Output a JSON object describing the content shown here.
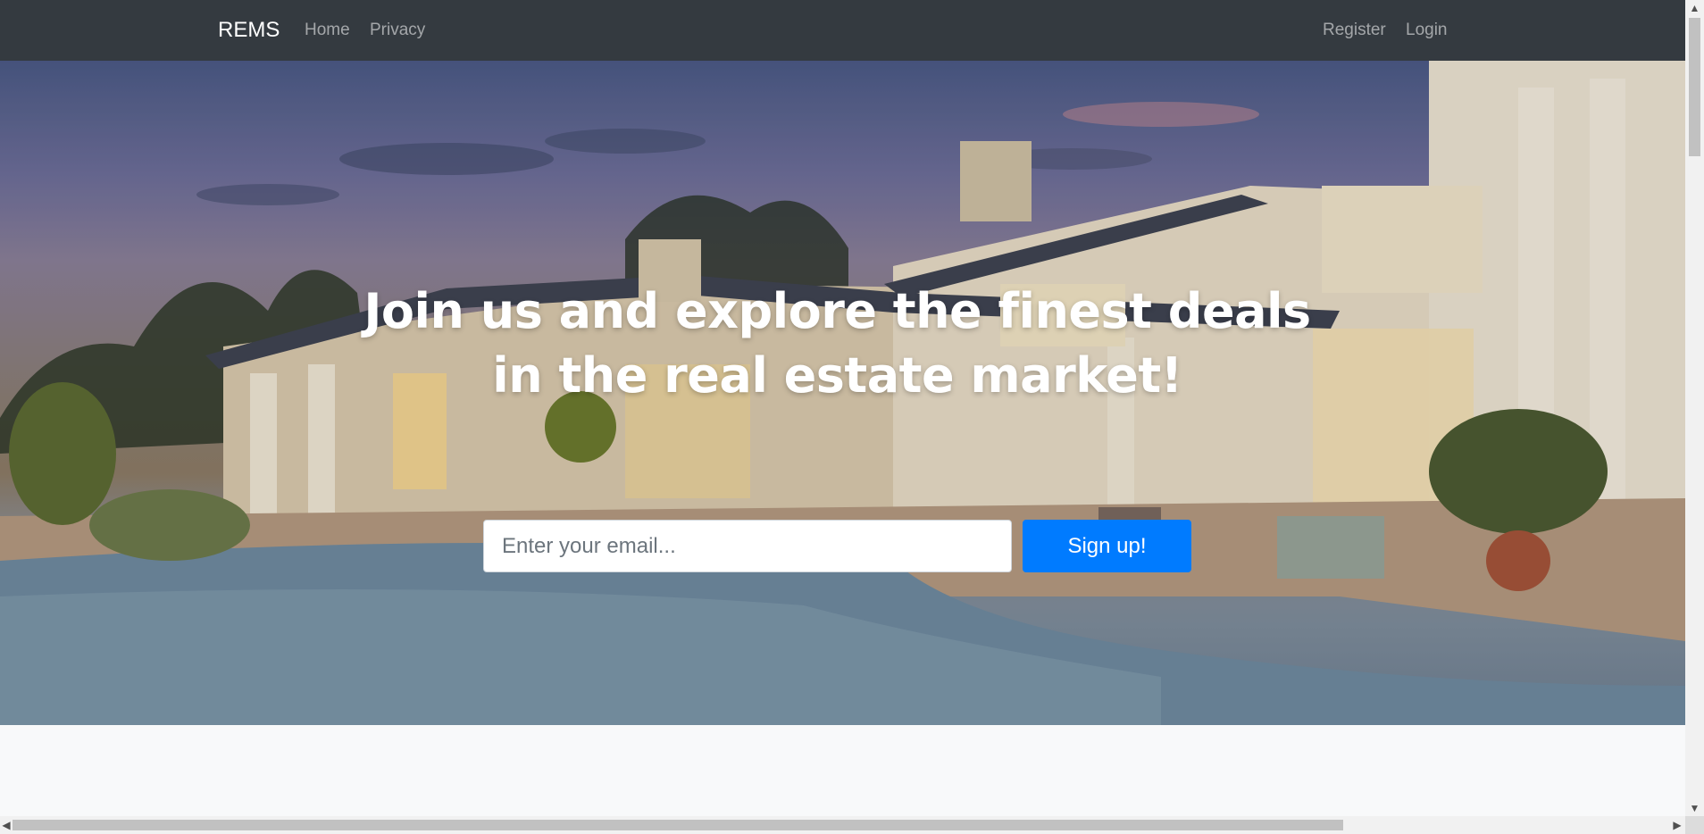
{
  "navbar": {
    "brand": "REMS",
    "left_links": [
      "Home",
      "Privacy"
    ],
    "right_links": [
      "Register",
      "Login"
    ],
    "background": "#343a40"
  },
  "hero": {
    "headline": "Join us and explore the finest deals in the real estate market!",
    "email_placeholder": "Enter your email...",
    "signup_label": "Sign up!",
    "accent_color": "#007bff"
  },
  "scrollbars": {
    "up_icon": "▲",
    "down_icon": "▼",
    "left_icon": "◀",
    "right_icon": "▶"
  }
}
